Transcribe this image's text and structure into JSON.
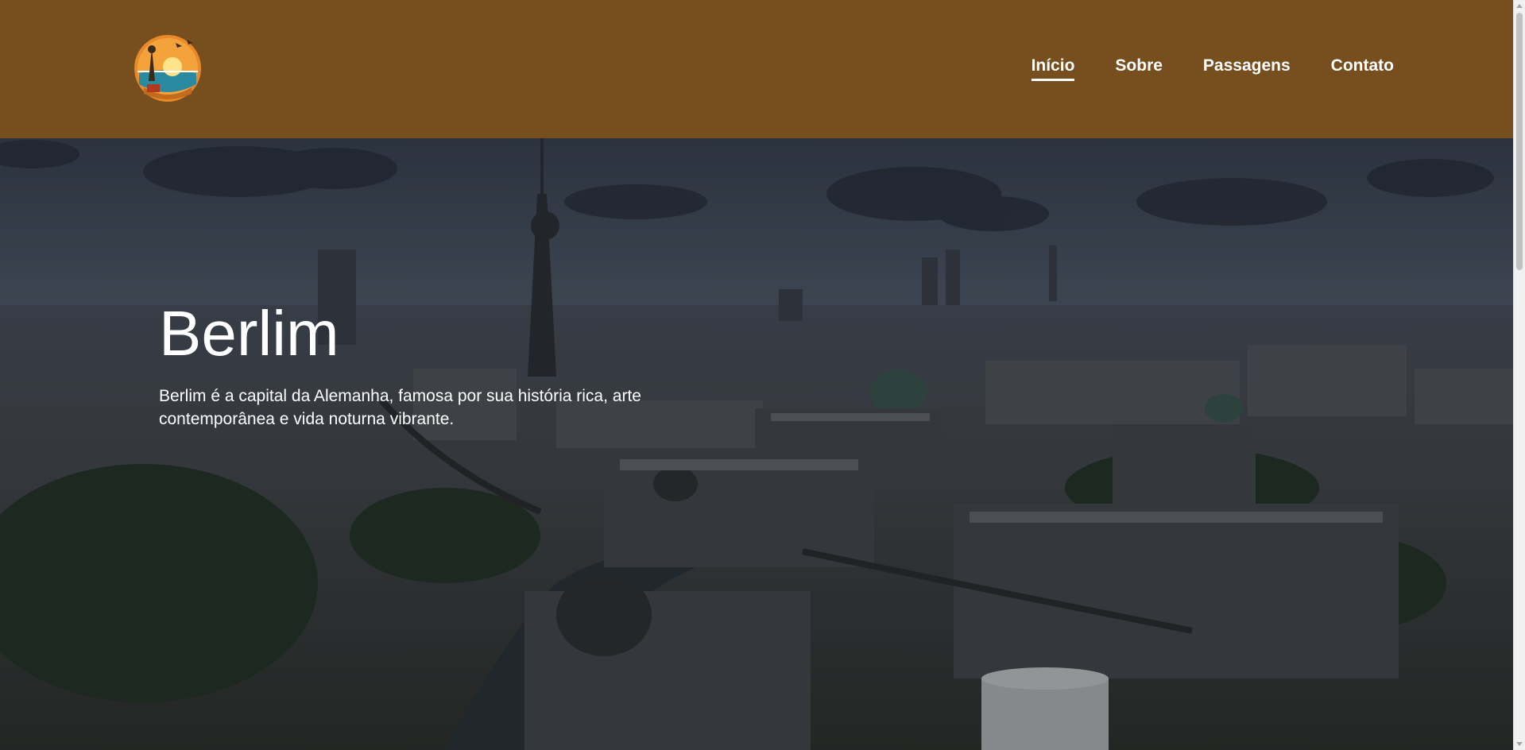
{
  "brand": {
    "logo_icon": "travel-logo-icon"
  },
  "nav": {
    "items": [
      {
        "label": "Início",
        "active": true
      },
      {
        "label": "Sobre",
        "active": false
      },
      {
        "label": "Passagens",
        "active": false
      },
      {
        "label": "Contato",
        "active": false
      }
    ]
  },
  "hero": {
    "title": "Berlim",
    "description": "Berlim é a capital da Alemanha, famosa por sua história rica, arte contemporânea e vida noturna vibrante."
  },
  "colors": {
    "header_bg": "#774f1f",
    "text": "#ffffff"
  }
}
